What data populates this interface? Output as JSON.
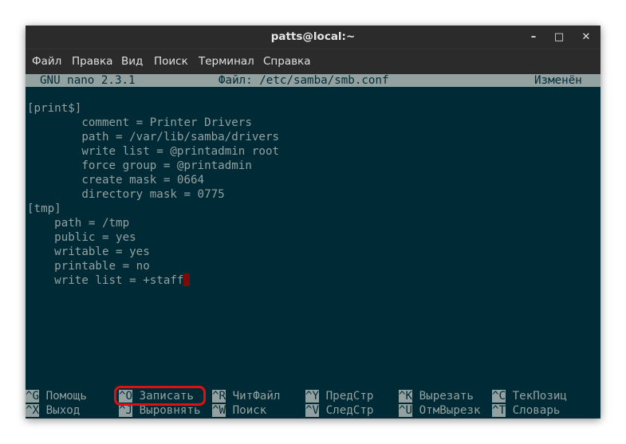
{
  "window": {
    "title": "patts@local:~",
    "controls": {
      "minimize": "–",
      "maximize": "□",
      "close": "✕"
    }
  },
  "menu": [
    "Файл",
    "Правка",
    "Вид",
    "Поиск",
    "Терминал",
    "Справка"
  ],
  "nano": {
    "version": "GNU nano 2.3.1",
    "file": "Файл: /etc/samba/smb.conf",
    "status": "Изменён"
  },
  "content_lines": [
    "[print$]",
    "        comment = Printer Drivers",
    "        path = /var/lib/samba/drivers",
    "        write list = @printadmin root",
    "        force group = @printadmin",
    "        create mask = 0664",
    "        directory mask = 0775",
    "[tmp]",
    "    path = /tmp",
    "    public = yes",
    "    writable = yes",
    "    printable = no",
    "    write list = +staff"
  ],
  "shortcuts": {
    "row1": [
      {
        "key": "^G",
        "label": "Помощь"
      },
      {
        "key": "^O",
        "label": "Записать"
      },
      {
        "key": "^R",
        "label": "ЧитФайл"
      },
      {
        "key": "^Y",
        "label": "ПредСтр"
      },
      {
        "key": "^K",
        "label": "Вырезать"
      },
      {
        "key": "^C",
        "label": "ТекПозиц"
      }
    ],
    "row2": [
      {
        "key": "^X",
        "label": "Выход"
      },
      {
        "key": "^J",
        "label": "Выровнять"
      },
      {
        "key": "^W",
        "label": "Поиск"
      },
      {
        "key": "^V",
        "label": "СледСтр"
      },
      {
        "key": "^U",
        "label": "ОтмВырезк"
      },
      {
        "key": "^T",
        "label": "Словарь"
      }
    ]
  },
  "colors": {
    "terminal_bg": "#002b36",
    "terminal_fg": "#93a1a1",
    "titlebar_bg": "#2b2b2b",
    "cursor": "#7a0b0b",
    "highlight": "#e01010"
  }
}
